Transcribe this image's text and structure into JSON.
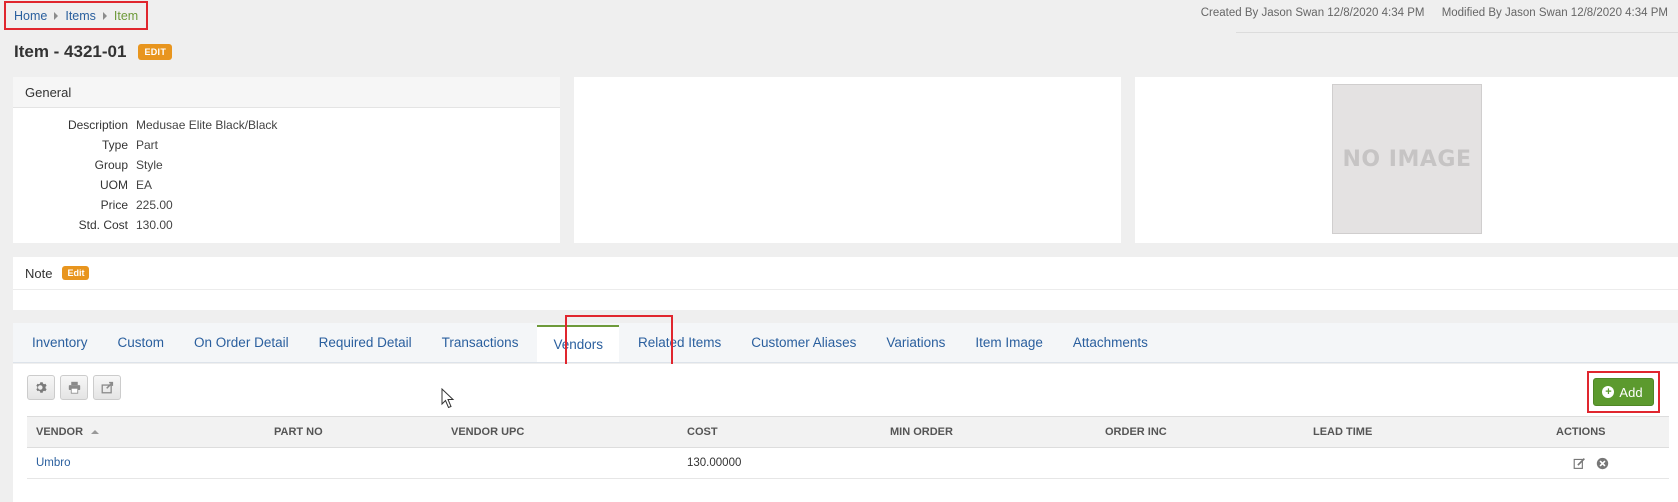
{
  "breadcrumb": {
    "items": [
      "Home",
      "Items",
      "Item"
    ]
  },
  "audit": {
    "created": "Created By Jason Swan 12/8/2020 4:34 PM",
    "modified": "Modified By Jason Swan 12/8/2020 4:34 PM"
  },
  "header": {
    "title": "Item - 4321-01",
    "edit_badge": "EDIT"
  },
  "general": {
    "heading": "General",
    "fields": [
      {
        "label": "Description",
        "value": "Medusae Elite Black/Black"
      },
      {
        "label": "Type",
        "value": "Part"
      },
      {
        "label": "Group",
        "value": "Style"
      },
      {
        "label": "UOM",
        "value": "EA"
      },
      {
        "label": "Price",
        "value": "225.00"
      },
      {
        "label": "Std. Cost",
        "value": "130.00"
      }
    ]
  },
  "image": {
    "placeholder": "NO IMAGE"
  },
  "note": {
    "heading": "Note",
    "edit_badge": "Edit"
  },
  "tabs": [
    {
      "label": "Inventory"
    },
    {
      "label": "Custom"
    },
    {
      "label": "On Order Detail"
    },
    {
      "label": "Required Detail"
    },
    {
      "label": "Transactions"
    },
    {
      "label": "Vendors",
      "active": true
    },
    {
      "label": "Related Items"
    },
    {
      "label": "Customer Aliases"
    },
    {
      "label": "Variations"
    },
    {
      "label": "Item Image"
    },
    {
      "label": "Attachments"
    }
  ],
  "toolbar": {
    "icons": [
      "gear-icon",
      "print-icon",
      "export-icon"
    ],
    "add_label": "Add"
  },
  "grid": {
    "columns": [
      "VENDOR",
      "PART NO",
      "VENDOR UPC",
      "COST",
      "MIN ORDER",
      "ORDER INC",
      "LEAD TIME",
      "ACTIONS"
    ],
    "rows": [
      {
        "vendor": "Umbro",
        "part_no": "",
        "vendor_upc": "",
        "cost": "130.00000",
        "min_order": "",
        "order_inc": "",
        "lead_time": ""
      }
    ]
  },
  "colors": {
    "link": "#2a5f9e",
    "accent_green": "#5c9a2e",
    "badge_orange": "#e8951e",
    "highlight_red": "#e0262e"
  }
}
